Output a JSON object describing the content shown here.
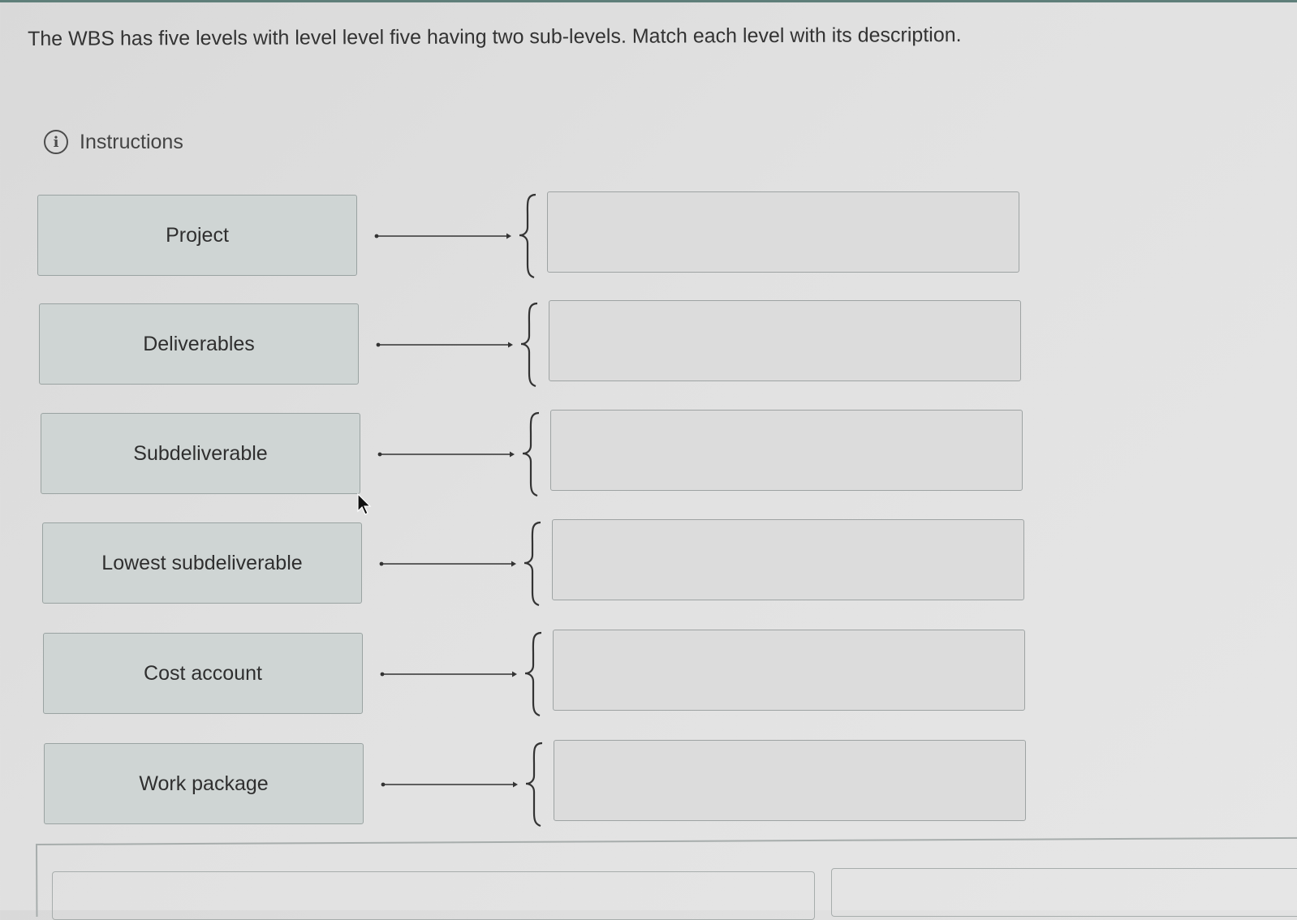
{
  "question": {
    "text": "The WBS has five levels with level level five having two sub-levels. Match each level with its description."
  },
  "instructions": {
    "label": "Instructions",
    "icon": "info-icon"
  },
  "matching": {
    "terms": [
      {
        "label": "Project"
      },
      {
        "label": "Deliverables"
      },
      {
        "label": "Subdeliverable"
      },
      {
        "label": "Lowest subdeliverable"
      },
      {
        "label": "Cost account"
      },
      {
        "label": "Work package"
      }
    ],
    "answer_slots": [
      "",
      "",
      "",
      "",
      "",
      ""
    ]
  },
  "colors": {
    "term_bg": "#cfd5d4",
    "dropzone_bg": "#dcdcdc",
    "border": "#9aa3a2",
    "top_rule": "#5f7f7a"
  }
}
